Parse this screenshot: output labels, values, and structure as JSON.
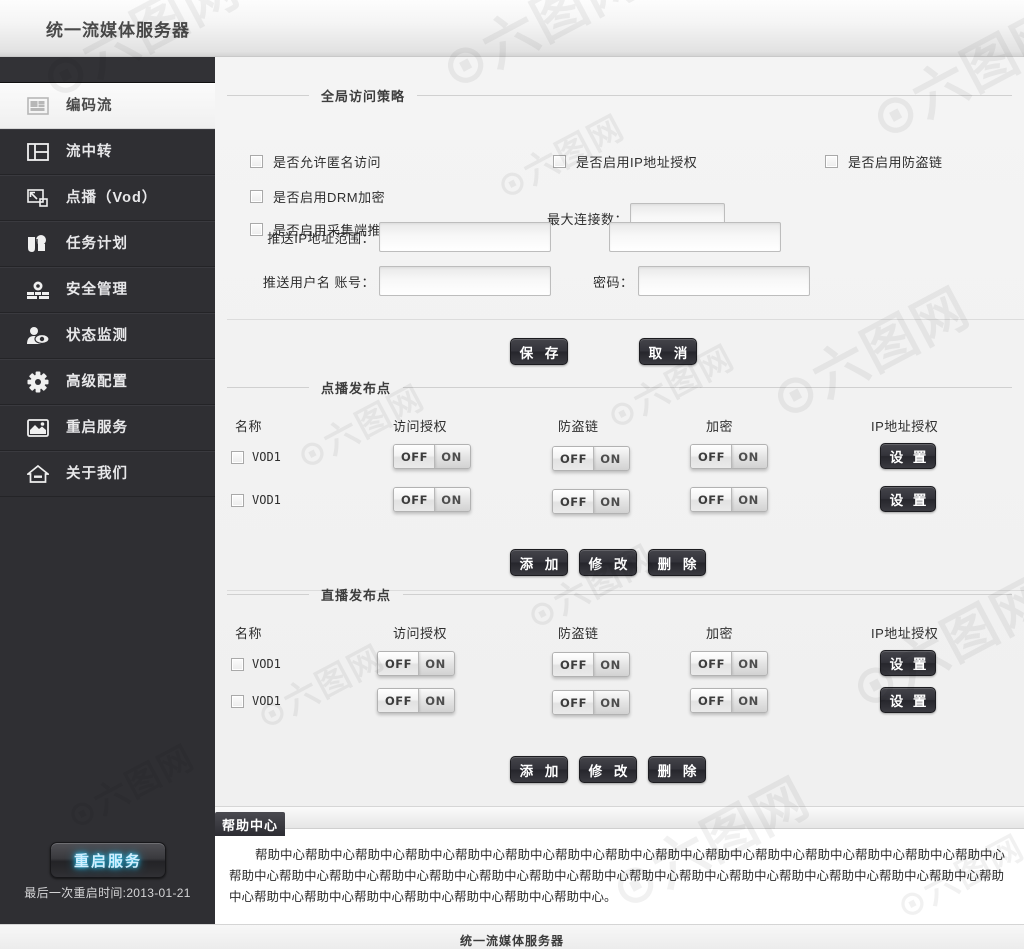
{
  "header": {
    "title": "统一流媒体服务器"
  },
  "sidebar": {
    "items": [
      {
        "label": "编码流",
        "icon": "encode-stream-icon",
        "active": true
      },
      {
        "label": "流中转",
        "icon": "relay-stream-icon",
        "active": false
      },
      {
        "label": "点播（Vod）",
        "icon": "vod-icon",
        "active": false
      },
      {
        "label": "任务计划",
        "icon": "task-plan-icon",
        "active": false
      },
      {
        "label": "安全管理",
        "icon": "security-icon",
        "active": false
      },
      {
        "label": "状态监测",
        "icon": "monitor-icon",
        "active": false
      },
      {
        "label": "高级配置",
        "icon": "gear-icon",
        "active": false
      },
      {
        "label": "重启服务",
        "icon": "restart-icon",
        "active": false
      },
      {
        "label": "关于我们",
        "icon": "home-icon",
        "active": false
      }
    ],
    "restart_button": "重启服务",
    "restart_time": "最后一次重启时间:2013-01-21"
  },
  "global_policy": {
    "group_title": "全局访问策略",
    "checkboxes": [
      {
        "label": "是否允许匿名访问",
        "checked": false
      },
      {
        "label": "是否启用DRM加密",
        "checked": false
      },
      {
        "label": "是否启用采集端推送策略",
        "checked": false
      },
      {
        "label": "是否启用IP地址授权",
        "checked": false
      },
      {
        "label": "是否启用防盗链",
        "checked": false
      }
    ],
    "max_conn_label": "最大连接数：",
    "max_conn_value": "",
    "ip_range_label": "推送IP地址范围：",
    "ip_range_start": "",
    "ip_range_end": "",
    "push_user_label": "推送用户名   账号：",
    "push_user_value": "",
    "password_label": "密码：",
    "password_value": "",
    "save_label": "保 存",
    "cancel_label": "取 消"
  },
  "vod_section": {
    "group_title": "点播发布点",
    "columns": [
      "名称",
      "访问授权",
      "防盗链",
      "加密",
      "IP地址授权"
    ],
    "setting_label": "设 置",
    "toggle_off": "OFF",
    "toggle_on": "ON",
    "rows": [
      {
        "name": "VOD1",
        "checked": false,
        "access": "off",
        "antisteal": "off",
        "encrypt": "off"
      },
      {
        "name": "VOD1",
        "checked": false,
        "access": "off",
        "antisteal": "off",
        "encrypt": "off"
      }
    ],
    "add_label": "添 加",
    "edit_label": "修 改",
    "delete_label": "删 除"
  },
  "live_section": {
    "group_title": "直播发布点",
    "columns": [
      "名称",
      "访问授权",
      "防盗链",
      "加密",
      "IP地址授权"
    ],
    "setting_label": "设 置",
    "toggle_off": "OFF",
    "toggle_on": "ON",
    "rows": [
      {
        "name": "VOD1",
        "checked": false,
        "access": "off",
        "antisteal": "off",
        "encrypt": "off"
      },
      {
        "name": "VOD1",
        "checked": false,
        "access": "off",
        "antisteal": "off",
        "encrypt": "off"
      }
    ],
    "add_label": "添 加",
    "edit_label": "修 改",
    "delete_label": "删 除"
  },
  "help": {
    "tab_label": "帮助中心",
    "text": "帮助中心帮助中心帮助中心帮助中心帮助中心帮助中心帮助中心帮助中心帮助中心帮助中心帮助中心帮助中心帮助中心帮助中心帮助中心帮助中心帮助中心帮助中心帮助中心帮助中心帮助中心帮助中心帮助中心帮助中心帮助中心帮助中心帮助中心帮助中心帮助中心帮助中心帮助中心帮助中心帮助中心帮助中心帮助中心帮助中心帮助中心帮助中心。"
  },
  "footer": {
    "text": "统一流媒体服务器"
  },
  "colors": {
    "sidebar_bg": "#2f2f33",
    "accent_glow": "#29c8f5",
    "panel_bg": "#f2f2f2",
    "button_dark": "#2d2d33"
  }
}
